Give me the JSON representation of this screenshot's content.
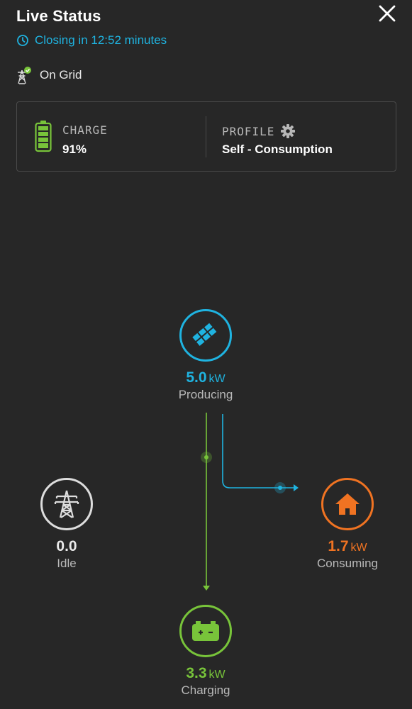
{
  "header": {
    "title": "Live Status",
    "countdown": "Closing in 12:52 minutes"
  },
  "grid_status": {
    "label": "On Grid"
  },
  "summary": {
    "charge_label": "CHARGE",
    "charge_value": "91%",
    "profile_label": "PROFILE",
    "profile_value": "Self - Consumption"
  },
  "nodes": {
    "solar": {
      "value": "5.0",
      "unit": "kW",
      "label": "Producing",
      "icon": "solar-panel-icon"
    },
    "grid": {
      "value": "0.0",
      "unit": "",
      "label": "Idle",
      "icon": "power-tower-icon"
    },
    "home": {
      "value": "1.7",
      "unit": "kW",
      "label": "Consuming",
      "icon": "house-icon"
    },
    "battery": {
      "value": "3.3",
      "unit": "kW",
      "label": "Charging",
      "icon": "battery-icon"
    }
  },
  "colors": {
    "solar": "#1fb3e0",
    "home": "#f07322",
    "battery": "#78c43a",
    "grid": "#dddddd",
    "background": "#272727"
  }
}
